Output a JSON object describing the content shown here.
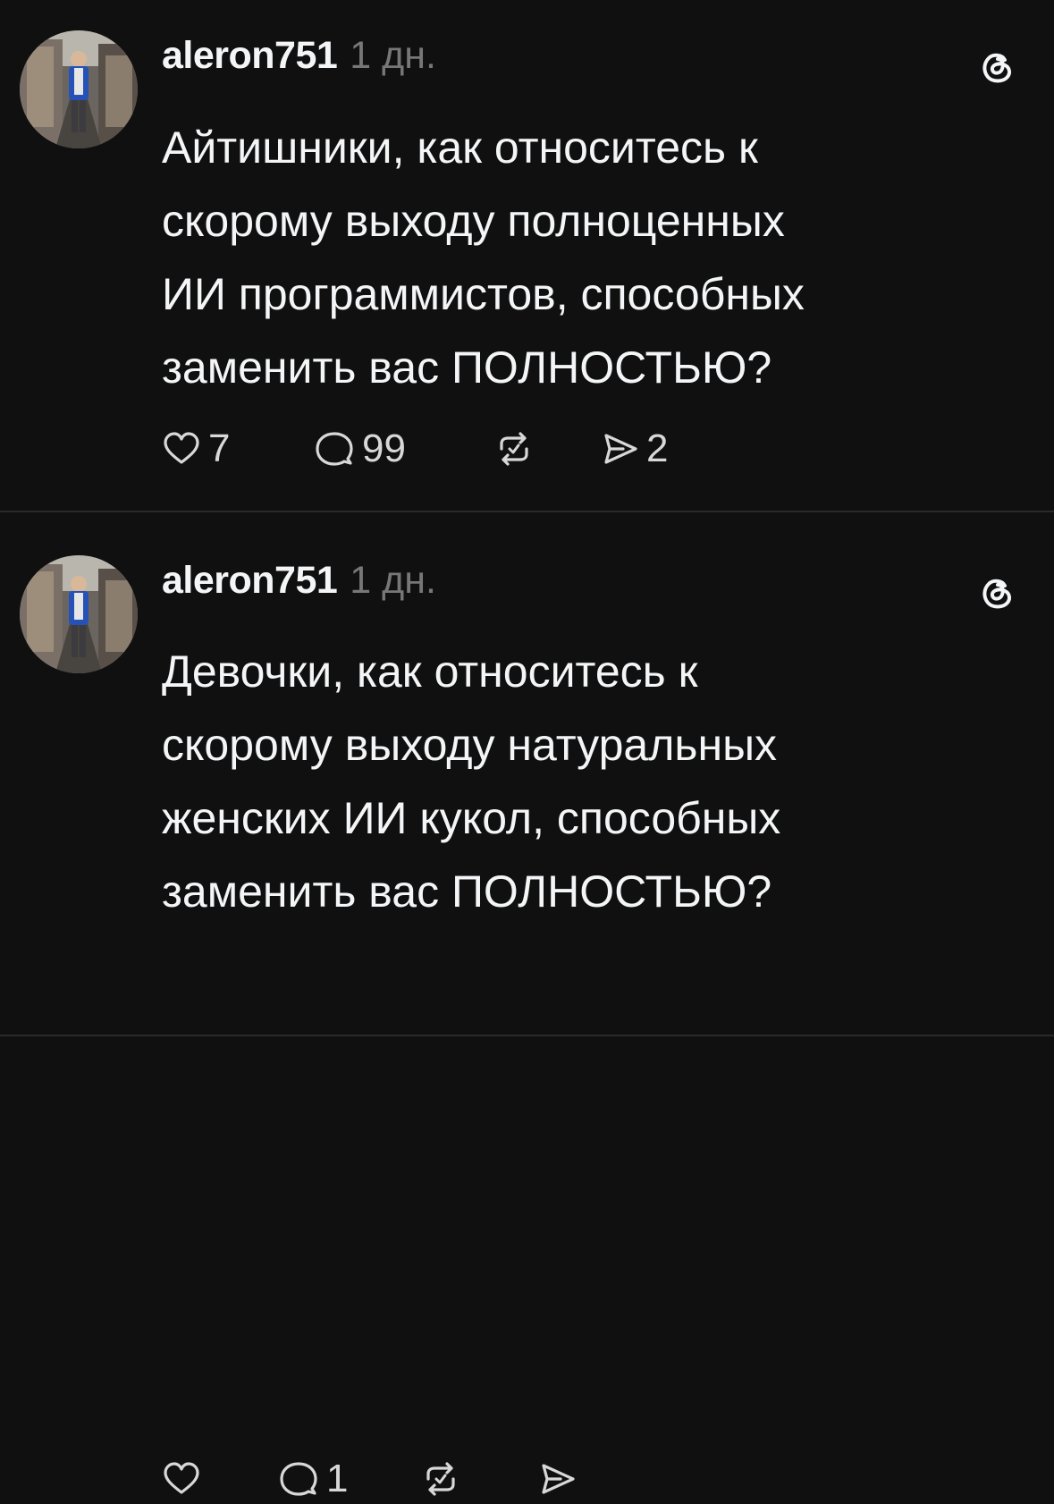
{
  "theme": {
    "background": "#101010",
    "text": "#f3f5f7",
    "muted": "#777777",
    "divider": "#2a2a2a"
  },
  "posts": [
    {
      "username": "aleron751",
      "time": "1 дн.",
      "text_lines": [
        "Айтишники, как относитесь к",
        "скорому выходу полноценных",
        "ИИ программистов, способных",
        "заменить вас ПОЛНОСТЬЮ?"
      ],
      "likes": "7",
      "replies": "99",
      "reposts": "",
      "shares": "2",
      "icons": [
        "avatar",
        "threads-icon",
        "heart-icon",
        "comment-icon",
        "repost-icon",
        "share-icon"
      ]
    },
    {
      "username": "aleron751",
      "time": "1 дн.",
      "text_lines": [
        "Девочки, как относитесь к",
        "скорому выходу натуральных",
        "женских ИИ кукол, способных",
        "заменить вас ПОЛНОСТЬЮ?"
      ],
      "likes": "",
      "replies": "1",
      "reposts": "",
      "shares": "",
      "icons": [
        "avatar",
        "threads-icon",
        "heart-icon",
        "comment-icon",
        "repost-icon",
        "share-icon"
      ]
    }
  ]
}
